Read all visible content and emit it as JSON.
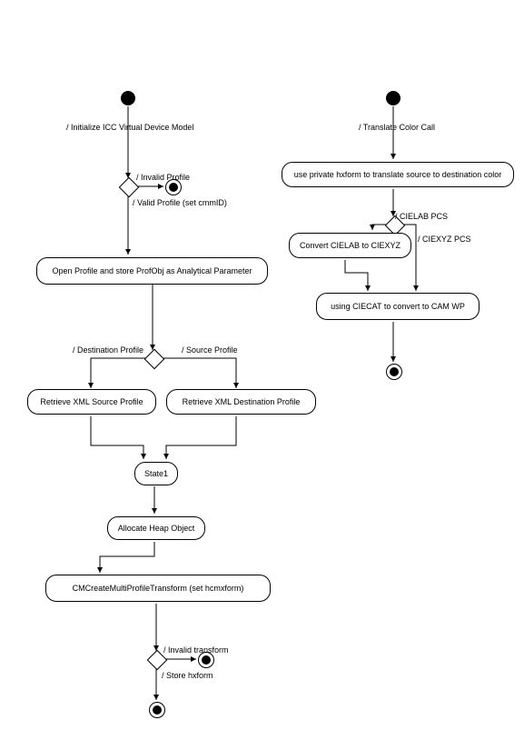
{
  "left": {
    "start_label": "/ Initialize ICC Virtual Device Model",
    "d1_invalid": "/ Invalid Profile",
    "d1_valid": "/ Valid Profile (set cmmID)",
    "open_profile": "Open Profile and store ProfObj as Analytical Parameter",
    "d2_dest": "/ Destination Profile",
    "d2_src": "/ Source Profile",
    "retrieve_src": "Retrieve XML Source Profile",
    "retrieve_dest": "Retrieve XML Destination Profile",
    "state1": "State1",
    "allocate": "Allocate Heap Object",
    "cmcreate": "CMCreateMultiProfileTransform (set hcmxform)",
    "d3_invalid": "/ Invalid transform",
    "d3_store": "/ Store hxform"
  },
  "right": {
    "start_label": "/ Translate Color Call",
    "use_private": "use private hxform to translate source to destination color",
    "d1_cielab": "/ CIELAB PCS",
    "d1_ciexyz": "/ CIEXYZ PCS",
    "convert_lab": "Convert CIELAB to CIEXYZ",
    "using_ciecat": "using CIECAT to convert to CAM WP"
  }
}
